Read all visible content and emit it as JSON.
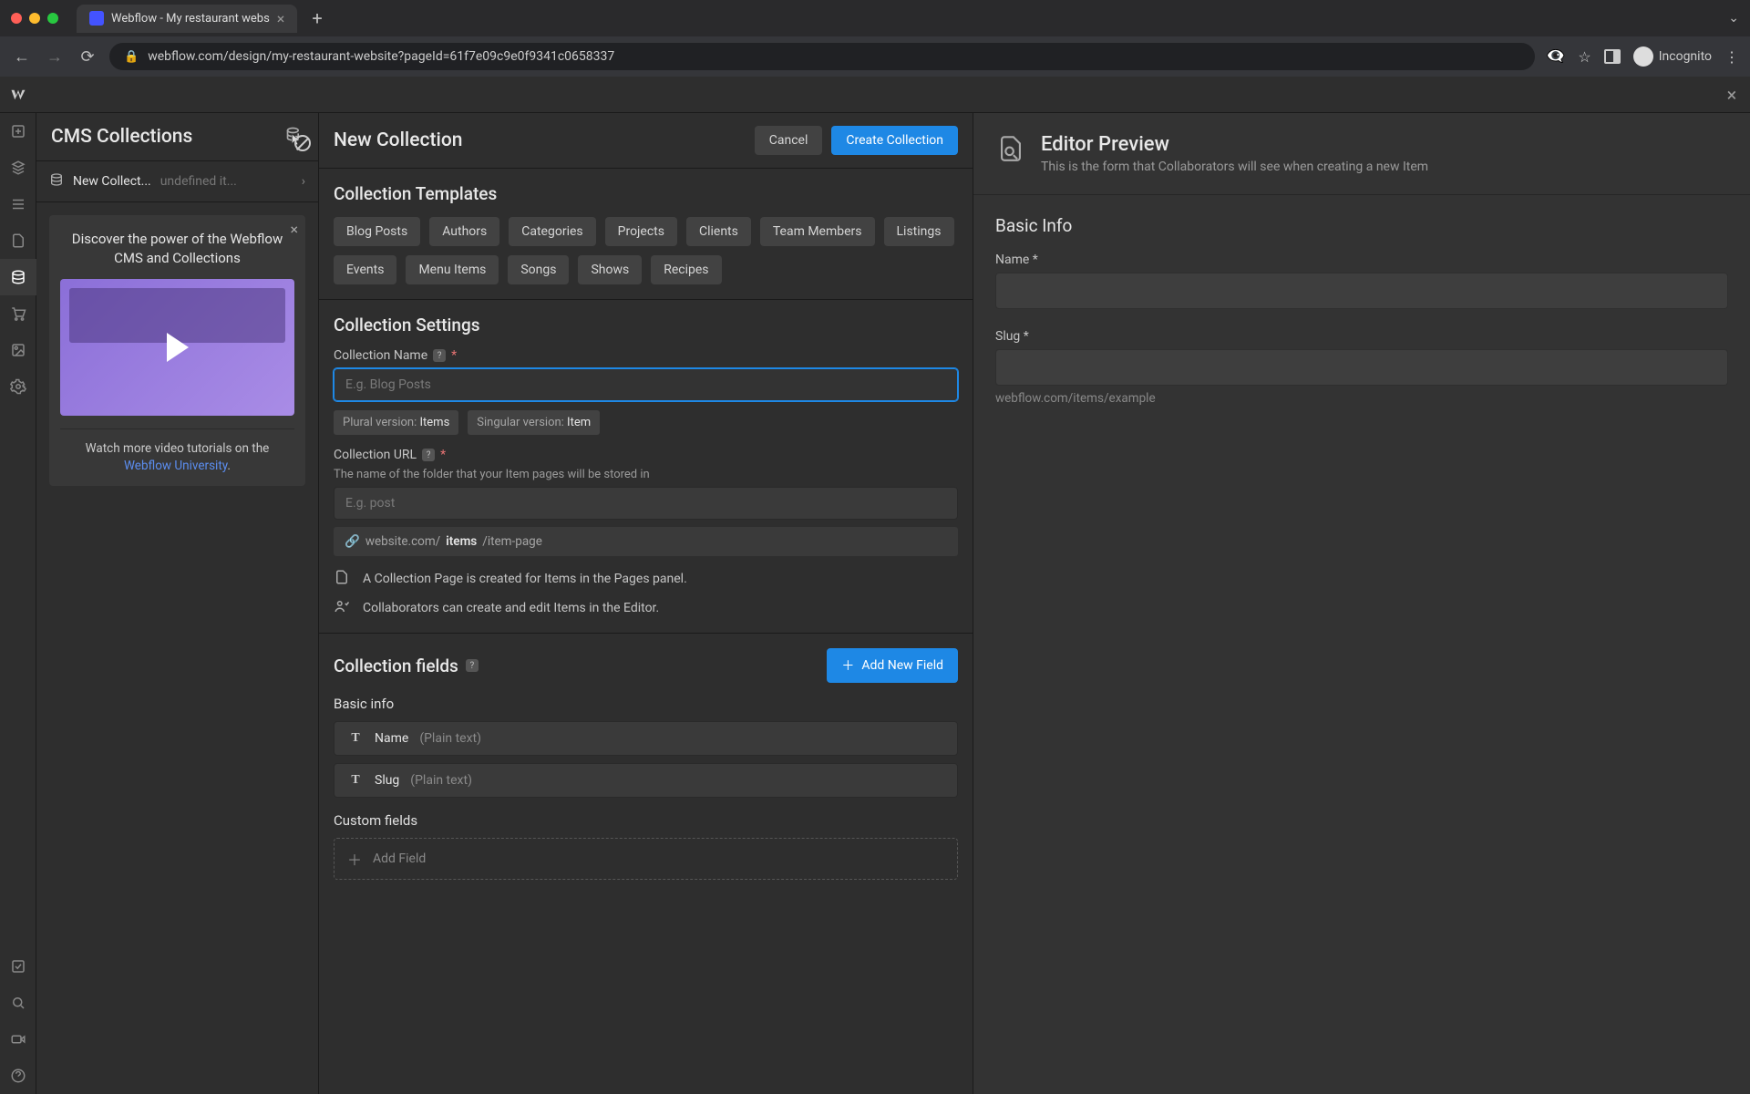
{
  "browser": {
    "tab_title": "Webflow - My restaurant webs",
    "url": "webflow.com/design/my-restaurant-website?pageId=61f7e09c9e0f9341c0658337",
    "incognito": "Incognito"
  },
  "left_panel": {
    "title": "CMS Collections",
    "item_name": "New Collect...",
    "item_meta": "undefined it...",
    "promo_title": "Discover the power of the Webflow CMS and Collections",
    "promo_foot_prefix": "Watch more video tutorials on the ",
    "promo_link": "Webflow University"
  },
  "collection_panel": {
    "title": "New Collection",
    "cancel": "Cancel",
    "create": "Create Collection",
    "templates_title": "Collection Templates",
    "templates": [
      "Blog Posts",
      "Authors",
      "Categories",
      "Projects",
      "Clients",
      "Team Members",
      "Listings",
      "Events",
      "Menu Items",
      "Songs",
      "Shows",
      "Recipes"
    ],
    "settings_title": "Collection Settings",
    "name_label": "Collection Name",
    "name_placeholder": "E.g. Blog Posts",
    "plural_key": "Plural version:",
    "plural_val": "Items",
    "singular_key": "Singular version:",
    "singular_val": "Item",
    "url_label": "Collection URL",
    "url_helper": "The name of the folder that your Item pages will be stored in",
    "url_placeholder": "E.g. post",
    "url_preview_pre": "website.com/",
    "url_preview_bold": "items",
    "url_preview_post": "/item-page",
    "info1": "A Collection Page is created for Items in the Pages panel.",
    "info2": "Collaborators can create and edit Items in the Editor.",
    "fields_title": "Collection fields",
    "add_field": "Add New Field",
    "basic_info": "Basic info",
    "field_name": "Name",
    "field_name_type": "(Plain text)",
    "field_slug": "Slug",
    "field_slug_type": "(Plain text)",
    "custom_fields": "Custom fields",
    "add_field_row": "Add Field"
  },
  "editor_preview": {
    "title": "Editor Preview",
    "subtitle": "This is the form that Collaborators will see when creating a new Item",
    "section": "Basic Info",
    "name_label": "Name *",
    "slug_label": "Slug *",
    "slug_hint": "webflow.com/items/example"
  }
}
